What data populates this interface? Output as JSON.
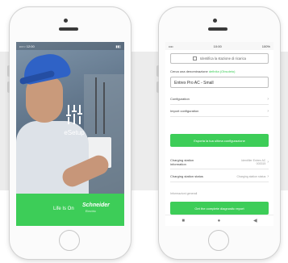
{
  "left_phone": {
    "status_bar": {
      "left": "••○○ 12:00",
      "right": "▮▮▯"
    },
    "app_name": "eSetup",
    "footer": {
      "tagline": "Life Is On",
      "brand": "Schneider",
      "brand_sub": "Electric"
    },
    "colors": {
      "accent": "#3dcd58"
    }
  },
  "right_phone": {
    "status_bar": {
      "left": "••••",
      "center": "10:00",
      "right": "100%"
    },
    "identify_button": "Identifica la stazione di ricarica",
    "denomination": {
      "label": "Cerca una denominazione",
      "link": "definita (Obsoleto)"
    },
    "denomination_input": "Entrex Pro AC - Small",
    "rows": [
      {
        "label": "Configuration",
        "value": ""
      },
      {
        "label": "Import configuration",
        "value": ""
      }
    ],
    "apply_button": "Esporta la tua ultima configurazione",
    "info_rows": [
      {
        "label": "Charging station information",
        "value": "Identifier Entrex AC 003315"
      },
      {
        "label": "Charging station status",
        "value": "Charging station status"
      }
    ],
    "tab_label": "Informazioni generali",
    "generate_button": "Get the complete diagnostic report",
    "nav": [
      "■",
      "●",
      "◀"
    ]
  }
}
